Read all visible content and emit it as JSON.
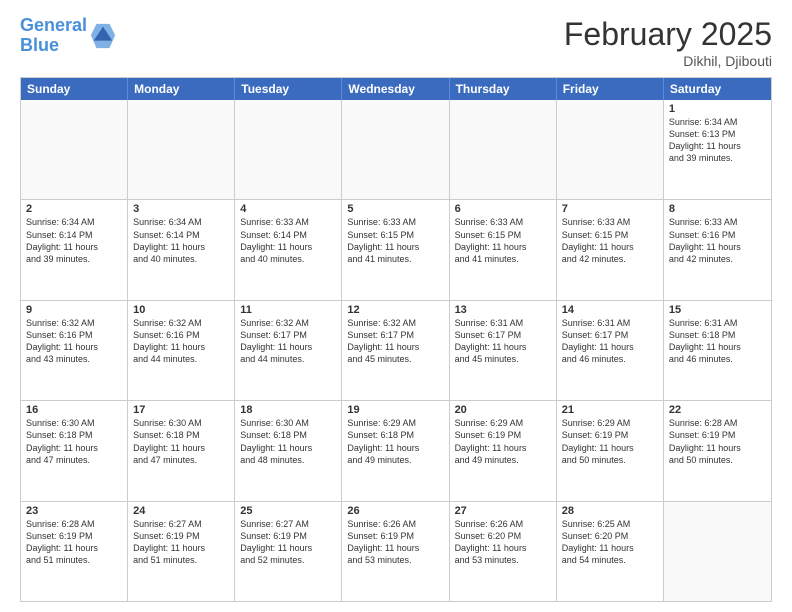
{
  "header": {
    "logo_general": "General",
    "logo_blue": "Blue",
    "month_title": "February 2025",
    "location": "Dikhil, Djibouti"
  },
  "weekdays": [
    "Sunday",
    "Monday",
    "Tuesday",
    "Wednesday",
    "Thursday",
    "Friday",
    "Saturday"
  ],
  "rows": [
    [
      {
        "day": "",
        "lines": [],
        "empty": true
      },
      {
        "day": "",
        "lines": [],
        "empty": true
      },
      {
        "day": "",
        "lines": [],
        "empty": true
      },
      {
        "day": "",
        "lines": [],
        "empty": true
      },
      {
        "day": "",
        "lines": [],
        "empty": true
      },
      {
        "day": "",
        "lines": [],
        "empty": true
      },
      {
        "day": "1",
        "lines": [
          "Sunrise: 6:34 AM",
          "Sunset: 6:13 PM",
          "Daylight: 11 hours",
          "and 39 minutes."
        ],
        "empty": false
      }
    ],
    [
      {
        "day": "2",
        "lines": [
          "Sunrise: 6:34 AM",
          "Sunset: 6:14 PM",
          "Daylight: 11 hours",
          "and 39 minutes."
        ],
        "empty": false
      },
      {
        "day": "3",
        "lines": [
          "Sunrise: 6:34 AM",
          "Sunset: 6:14 PM",
          "Daylight: 11 hours",
          "and 40 minutes."
        ],
        "empty": false
      },
      {
        "day": "4",
        "lines": [
          "Sunrise: 6:33 AM",
          "Sunset: 6:14 PM",
          "Daylight: 11 hours",
          "and 40 minutes."
        ],
        "empty": false
      },
      {
        "day": "5",
        "lines": [
          "Sunrise: 6:33 AM",
          "Sunset: 6:15 PM",
          "Daylight: 11 hours",
          "and 41 minutes."
        ],
        "empty": false
      },
      {
        "day": "6",
        "lines": [
          "Sunrise: 6:33 AM",
          "Sunset: 6:15 PM",
          "Daylight: 11 hours",
          "and 41 minutes."
        ],
        "empty": false
      },
      {
        "day": "7",
        "lines": [
          "Sunrise: 6:33 AM",
          "Sunset: 6:15 PM",
          "Daylight: 11 hours",
          "and 42 minutes."
        ],
        "empty": false
      },
      {
        "day": "8",
        "lines": [
          "Sunrise: 6:33 AM",
          "Sunset: 6:16 PM",
          "Daylight: 11 hours",
          "and 42 minutes."
        ],
        "empty": false
      }
    ],
    [
      {
        "day": "9",
        "lines": [
          "Sunrise: 6:32 AM",
          "Sunset: 6:16 PM",
          "Daylight: 11 hours",
          "and 43 minutes."
        ],
        "empty": false
      },
      {
        "day": "10",
        "lines": [
          "Sunrise: 6:32 AM",
          "Sunset: 6:16 PM",
          "Daylight: 11 hours",
          "and 44 minutes."
        ],
        "empty": false
      },
      {
        "day": "11",
        "lines": [
          "Sunrise: 6:32 AM",
          "Sunset: 6:17 PM",
          "Daylight: 11 hours",
          "and 44 minutes."
        ],
        "empty": false
      },
      {
        "day": "12",
        "lines": [
          "Sunrise: 6:32 AM",
          "Sunset: 6:17 PM",
          "Daylight: 11 hours",
          "and 45 minutes."
        ],
        "empty": false
      },
      {
        "day": "13",
        "lines": [
          "Sunrise: 6:31 AM",
          "Sunset: 6:17 PM",
          "Daylight: 11 hours",
          "and 45 minutes."
        ],
        "empty": false
      },
      {
        "day": "14",
        "lines": [
          "Sunrise: 6:31 AM",
          "Sunset: 6:17 PM",
          "Daylight: 11 hours",
          "and 46 minutes."
        ],
        "empty": false
      },
      {
        "day": "15",
        "lines": [
          "Sunrise: 6:31 AM",
          "Sunset: 6:18 PM",
          "Daylight: 11 hours",
          "and 46 minutes."
        ],
        "empty": false
      }
    ],
    [
      {
        "day": "16",
        "lines": [
          "Sunrise: 6:30 AM",
          "Sunset: 6:18 PM",
          "Daylight: 11 hours",
          "and 47 minutes."
        ],
        "empty": false
      },
      {
        "day": "17",
        "lines": [
          "Sunrise: 6:30 AM",
          "Sunset: 6:18 PM",
          "Daylight: 11 hours",
          "and 47 minutes."
        ],
        "empty": false
      },
      {
        "day": "18",
        "lines": [
          "Sunrise: 6:30 AM",
          "Sunset: 6:18 PM",
          "Daylight: 11 hours",
          "and 48 minutes."
        ],
        "empty": false
      },
      {
        "day": "19",
        "lines": [
          "Sunrise: 6:29 AM",
          "Sunset: 6:18 PM",
          "Daylight: 11 hours",
          "and 49 minutes."
        ],
        "empty": false
      },
      {
        "day": "20",
        "lines": [
          "Sunrise: 6:29 AM",
          "Sunset: 6:19 PM",
          "Daylight: 11 hours",
          "and 49 minutes."
        ],
        "empty": false
      },
      {
        "day": "21",
        "lines": [
          "Sunrise: 6:29 AM",
          "Sunset: 6:19 PM",
          "Daylight: 11 hours",
          "and 50 minutes."
        ],
        "empty": false
      },
      {
        "day": "22",
        "lines": [
          "Sunrise: 6:28 AM",
          "Sunset: 6:19 PM",
          "Daylight: 11 hours",
          "and 50 minutes."
        ],
        "empty": false
      }
    ],
    [
      {
        "day": "23",
        "lines": [
          "Sunrise: 6:28 AM",
          "Sunset: 6:19 PM",
          "Daylight: 11 hours",
          "and 51 minutes."
        ],
        "empty": false
      },
      {
        "day": "24",
        "lines": [
          "Sunrise: 6:27 AM",
          "Sunset: 6:19 PM",
          "Daylight: 11 hours",
          "and 51 minutes."
        ],
        "empty": false
      },
      {
        "day": "25",
        "lines": [
          "Sunrise: 6:27 AM",
          "Sunset: 6:19 PM",
          "Daylight: 11 hours",
          "and 52 minutes."
        ],
        "empty": false
      },
      {
        "day": "26",
        "lines": [
          "Sunrise: 6:26 AM",
          "Sunset: 6:19 PM",
          "Daylight: 11 hours",
          "and 53 minutes."
        ],
        "empty": false
      },
      {
        "day": "27",
        "lines": [
          "Sunrise: 6:26 AM",
          "Sunset: 6:20 PM",
          "Daylight: 11 hours",
          "and 53 minutes."
        ],
        "empty": false
      },
      {
        "day": "28",
        "lines": [
          "Sunrise: 6:25 AM",
          "Sunset: 6:20 PM",
          "Daylight: 11 hours",
          "and 54 minutes."
        ],
        "empty": false
      },
      {
        "day": "",
        "lines": [],
        "empty": true
      }
    ]
  ]
}
